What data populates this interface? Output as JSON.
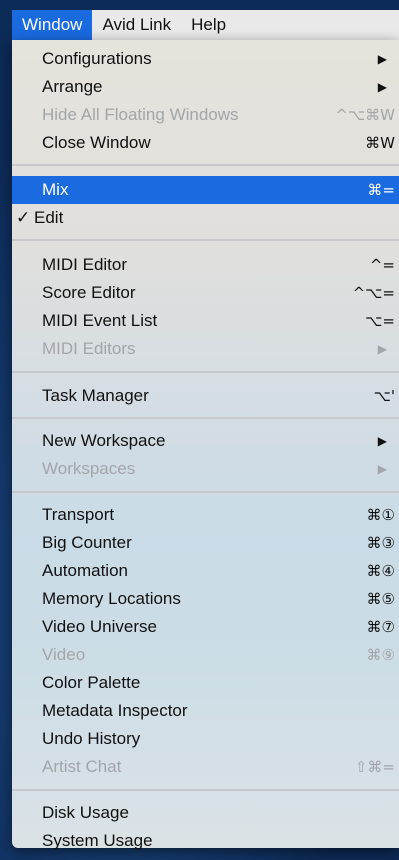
{
  "menubar": {
    "window": "Window",
    "avid_link": "Avid Link",
    "help": "Help"
  },
  "items": {
    "configurations": "Configurations",
    "arrange": "Arrange",
    "hide_floating": "Hide All Floating Windows",
    "hide_floating_shortcut": "^⌥⌘W",
    "close_window": "Close Window",
    "close_window_shortcut": "⌘W",
    "mix": "Mix",
    "mix_shortcut": "⌘=",
    "edit": "Edit",
    "edit_check": "✓",
    "midi_editor": "MIDI Editor",
    "midi_editor_shortcut": "^=",
    "score_editor": "Score Editor",
    "score_editor_shortcut": "^⌥=",
    "midi_event_list": "MIDI Event List",
    "midi_event_list_shortcut": "⌥=",
    "midi_editors": "MIDI Editors",
    "task_manager": "Task Manager",
    "task_manager_shortcut": "⌥'",
    "new_workspace": "New Workspace",
    "workspaces": "Workspaces",
    "transport": "Transport",
    "transport_shortcut": "⌘①",
    "big_counter": "Big Counter",
    "big_counter_shortcut": "⌘③",
    "automation": "Automation",
    "automation_shortcut": "⌘④",
    "memory_locations": "Memory Locations",
    "memory_locations_shortcut": "⌘⑤",
    "video_universe": "Video Universe",
    "video_universe_shortcut": "⌘⑦",
    "video": "Video",
    "video_shortcut": "⌘⑨",
    "color_palette": "Color Palette",
    "metadata_inspector": "Metadata Inspector",
    "undo_history": "Undo History",
    "artist_chat": "Artist Chat",
    "artist_chat_shortcut": "⇧⌘=",
    "disk_usage": "Disk Usage",
    "system_usage": "System Usage"
  },
  "icons": {
    "submenu_arrow": "▶"
  },
  "colors": {
    "highlight": "#1a6ae0",
    "disabled_text": "#a2a6aa",
    "desktop": "#0d2b57"
  }
}
